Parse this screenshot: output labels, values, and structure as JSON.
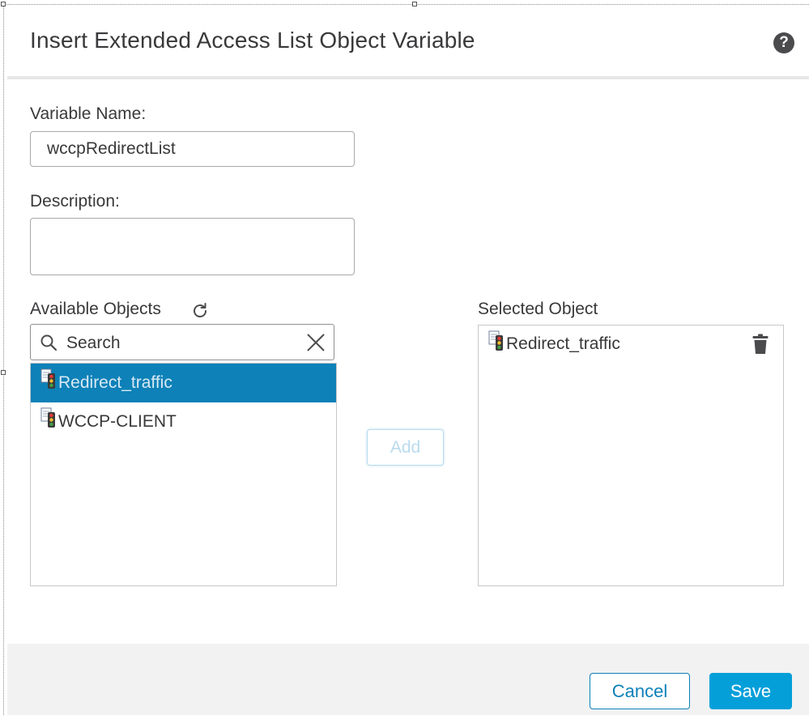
{
  "dialog": {
    "title": "Insert Extended Access List Object Variable",
    "help_icon": "question-circle-icon"
  },
  "variable_name": {
    "label": "Variable Name:",
    "value": "wccpRedirectList"
  },
  "description": {
    "label": "Description:",
    "value": ""
  },
  "available_objects": {
    "label": "Available Objects",
    "refresh_icon": "refresh-icon",
    "search": {
      "placeholder": "Search",
      "value": ""
    },
    "items": [
      {
        "label": "Redirect_traffic",
        "icon": "traffic-light-icon",
        "selected": true
      },
      {
        "label": "WCCP-CLIENT",
        "icon": "traffic-light-icon",
        "selected": false
      }
    ]
  },
  "add_button": {
    "label": "Add",
    "enabled": false
  },
  "selected_object": {
    "label": "Selected Object",
    "items": [
      {
        "label": "Redirect_traffic",
        "icon": "traffic-light-icon"
      }
    ]
  },
  "footer": {
    "cancel_label": "Cancel",
    "save_label": "Save"
  },
  "colors": {
    "accent": "#049fd9",
    "selection": "#0d81b8",
    "text": "#39393b"
  }
}
